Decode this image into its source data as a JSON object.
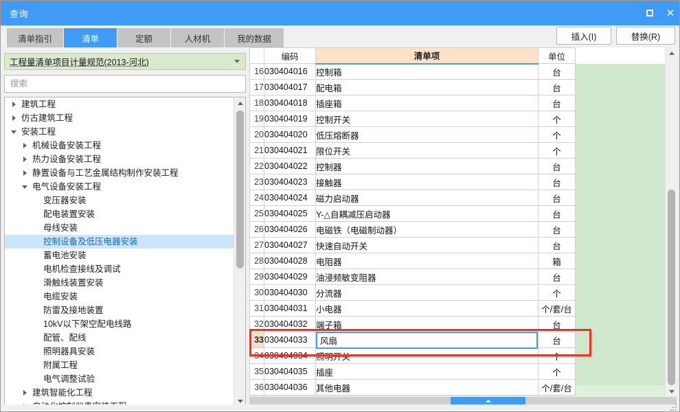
{
  "window": {
    "title": "查询",
    "controls": {
      "maximize": "□",
      "close": "✕"
    }
  },
  "tabs": [
    {
      "label": "清单指引",
      "active": false
    },
    {
      "label": "清单",
      "active": true
    },
    {
      "label": "定额",
      "active": false
    },
    {
      "label": "人材机",
      "active": false
    },
    {
      "label": "我的数据",
      "active": false
    }
  ],
  "toolbar": {
    "insert_label": "插入(I)",
    "replace_label": "替换(R)"
  },
  "left": {
    "standard_combo": {
      "value": "工程量清单项目计量规范(2013-河北)",
      "arrow": "chevron-down-icon"
    },
    "search": {
      "value": "",
      "placeholder": "搜索"
    },
    "tree": [
      {
        "label": "建筑工程",
        "depth": 1,
        "state": "collapsed",
        "selected": false
      },
      {
        "label": "仿古建筑工程",
        "depth": 1,
        "state": "collapsed",
        "selected": false
      },
      {
        "label": "安装工程",
        "depth": 1,
        "state": "expanded",
        "selected": false
      },
      {
        "label": "机械设备安装工程",
        "depth": 2,
        "state": "collapsed",
        "selected": false
      },
      {
        "label": "热力设备安装工程",
        "depth": 2,
        "state": "collapsed",
        "selected": false
      },
      {
        "label": "静置设备与工艺金属结构制作安装工程",
        "depth": 2,
        "state": "collapsed",
        "selected": false
      },
      {
        "label": "电气设备安装工程",
        "depth": 2,
        "state": "expanded",
        "selected": false
      },
      {
        "label": "变压器安装",
        "depth": 3,
        "state": "leaf",
        "selected": false
      },
      {
        "label": "配电装置安装",
        "depth": 3,
        "state": "leaf",
        "selected": false
      },
      {
        "label": "母线安装",
        "depth": 3,
        "state": "leaf",
        "selected": false
      },
      {
        "label": "控制设备及低压电器安装",
        "depth": 3,
        "state": "leaf",
        "selected": true
      },
      {
        "label": "蓄电池安装",
        "depth": 3,
        "state": "leaf",
        "selected": false
      },
      {
        "label": "电机检查接线及调试",
        "depth": 3,
        "state": "leaf",
        "selected": false
      },
      {
        "label": "滑触线装置安装",
        "depth": 3,
        "state": "leaf",
        "selected": false
      },
      {
        "label": "电缆安装",
        "depth": 3,
        "state": "leaf",
        "selected": false
      },
      {
        "label": "防雷及接地装置",
        "depth": 3,
        "state": "leaf",
        "selected": false
      },
      {
        "label": "10kV以下架空配电线路",
        "depth": 3,
        "state": "leaf",
        "selected": false
      },
      {
        "label": "配管、配线",
        "depth": 3,
        "state": "leaf",
        "selected": false
      },
      {
        "label": "照明器具安装",
        "depth": 3,
        "state": "leaf",
        "selected": false
      },
      {
        "label": "附属工程",
        "depth": 3,
        "state": "leaf",
        "selected": false
      },
      {
        "label": "电气调整试验",
        "depth": 3,
        "state": "leaf",
        "selected": false
      },
      {
        "label": "建筑智能化工程",
        "depth": 2,
        "state": "collapsed",
        "selected": false
      },
      {
        "label": "自动化控制仪表安装工程",
        "depth": 2,
        "state": "collapsed",
        "selected": false
      }
    ]
  },
  "grid": {
    "columns": [
      {
        "key": "rn",
        "label": "",
        "accent": false
      },
      {
        "key": "code",
        "label": "编码",
        "accent": false
      },
      {
        "key": "item",
        "label": "清单项",
        "accent": true
      },
      {
        "key": "unit",
        "label": "单位",
        "accent": false
      }
    ],
    "rows": [
      {
        "rn": "16",
        "code": "030404016",
        "item": "控制箱",
        "unit": "台",
        "editing": false,
        "selected": false
      },
      {
        "rn": "17",
        "code": "030404017",
        "item": "配电箱",
        "unit": "台",
        "editing": false,
        "selected": false
      },
      {
        "rn": "18",
        "code": "030404018",
        "item": "插座箱",
        "unit": "台",
        "editing": false,
        "selected": false
      },
      {
        "rn": "19",
        "code": "030404019",
        "item": "控制开关",
        "unit": "个",
        "editing": false,
        "selected": false
      },
      {
        "rn": "20",
        "code": "030404020",
        "item": "低压熔断器",
        "unit": "个",
        "editing": false,
        "selected": false
      },
      {
        "rn": "21",
        "code": "030404021",
        "item": "限位开关",
        "unit": "个",
        "editing": false,
        "selected": false
      },
      {
        "rn": "22",
        "code": "030404022",
        "item": "控制器",
        "unit": "台",
        "editing": false,
        "selected": false
      },
      {
        "rn": "23",
        "code": "030404023",
        "item": "接触器",
        "unit": "台",
        "editing": false,
        "selected": false
      },
      {
        "rn": "24",
        "code": "030404024",
        "item": "磁力启动器",
        "unit": "台",
        "editing": false,
        "selected": false
      },
      {
        "rn": "25",
        "code": "030404025",
        "item": "Y-△自耦减压启动器",
        "unit": "台",
        "editing": false,
        "selected": false
      },
      {
        "rn": "26",
        "code": "030404026",
        "item": "电磁铁（电磁制动器）",
        "unit": "台",
        "editing": false,
        "selected": false
      },
      {
        "rn": "27",
        "code": "030404027",
        "item": "快速自动开关",
        "unit": "台",
        "editing": false,
        "selected": false
      },
      {
        "rn": "28",
        "code": "030404028",
        "item": "电阻器",
        "unit": "箱",
        "editing": false,
        "selected": false
      },
      {
        "rn": "29",
        "code": "030404029",
        "item": "油浸频敏变阻器",
        "unit": "台",
        "editing": false,
        "selected": false
      },
      {
        "rn": "30",
        "code": "030404030",
        "item": "分流器",
        "unit": "个",
        "editing": false,
        "selected": false
      },
      {
        "rn": "31",
        "code": "030404031",
        "item": "小电器",
        "unit": "个/套/台",
        "editing": false,
        "selected": false
      },
      {
        "rn": "32",
        "code": "030404032",
        "item": "端子箱",
        "unit": "台",
        "editing": false,
        "selected": false
      },
      {
        "rn": "33",
        "code": "030404033",
        "item": "风扇",
        "unit": "台",
        "editing": true,
        "selected": true
      },
      {
        "rn": "34",
        "code": "030404034",
        "item": "照明开关",
        "unit": "个",
        "editing": false,
        "selected": false
      },
      {
        "rn": "35",
        "code": "030404035",
        "item": "插座",
        "unit": "个",
        "editing": false,
        "selected": false
      },
      {
        "rn": "36",
        "code": "030404036",
        "item": "其他电器",
        "unit": "个/套/台",
        "editing": false,
        "selected": false
      }
    ]
  },
  "colors": {
    "title_bar": "#3f9bf5",
    "accent": "#3f9bf5",
    "header_accent": "#fce3c8",
    "tree_selection": "#cde5fb",
    "highlight_box": "#f52e1e",
    "green_panel": "#cfe7cd",
    "combo_green": "#d9e9cd"
  }
}
